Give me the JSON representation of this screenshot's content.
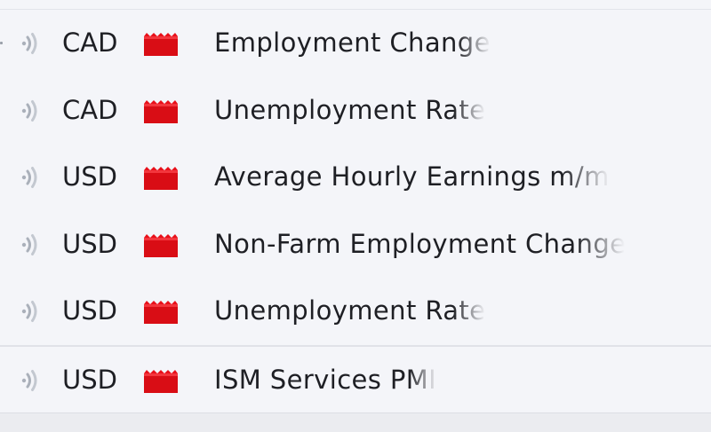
{
  "calendar": {
    "events": [
      {
        "currency": "CAD",
        "impact_icon": "high-impact-folder-icon",
        "event": "Employment Change"
      },
      {
        "currency": "CAD",
        "impact_icon": "high-impact-folder-icon",
        "event": "Unemployment Rate"
      },
      {
        "currency": "USD",
        "impact_icon": "high-impact-folder-icon",
        "event": "Average Hourly Earnings m/m"
      },
      {
        "currency": "USD",
        "impact_icon": "high-impact-folder-icon",
        "event": "Non-Farm Employment Change"
      },
      {
        "currency": "USD",
        "impact_icon": "high-impact-folder-icon",
        "event": "Unemployment Rate"
      },
      {
        "currency": "USD",
        "impact_icon": "high-impact-folder-icon",
        "event": "ISM Services PMI"
      }
    ]
  },
  "colors": {
    "background": "#f4f5f9",
    "text": "#1e1f24",
    "impact_high": "#e8101a",
    "sound_icon": "#aab0ba"
  }
}
